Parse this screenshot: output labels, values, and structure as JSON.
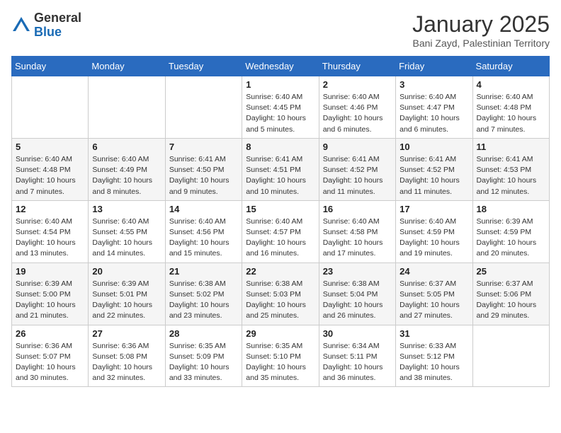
{
  "logo": {
    "general": "General",
    "blue": "Blue"
  },
  "header": {
    "month": "January 2025",
    "location": "Bani Zayd, Palestinian Territory"
  },
  "weekdays": [
    "Sunday",
    "Monday",
    "Tuesday",
    "Wednesday",
    "Thursday",
    "Friday",
    "Saturday"
  ],
  "weeks": [
    [
      {
        "day": "",
        "info": ""
      },
      {
        "day": "",
        "info": ""
      },
      {
        "day": "",
        "info": ""
      },
      {
        "day": "1",
        "info": "Sunrise: 6:40 AM\nSunset: 4:45 PM\nDaylight: 10 hours\nand 5 minutes."
      },
      {
        "day": "2",
        "info": "Sunrise: 6:40 AM\nSunset: 4:46 PM\nDaylight: 10 hours\nand 6 minutes."
      },
      {
        "day": "3",
        "info": "Sunrise: 6:40 AM\nSunset: 4:47 PM\nDaylight: 10 hours\nand 6 minutes."
      },
      {
        "day": "4",
        "info": "Sunrise: 6:40 AM\nSunset: 4:48 PM\nDaylight: 10 hours\nand 7 minutes."
      }
    ],
    [
      {
        "day": "5",
        "info": "Sunrise: 6:40 AM\nSunset: 4:48 PM\nDaylight: 10 hours\nand 7 minutes."
      },
      {
        "day": "6",
        "info": "Sunrise: 6:40 AM\nSunset: 4:49 PM\nDaylight: 10 hours\nand 8 minutes."
      },
      {
        "day": "7",
        "info": "Sunrise: 6:41 AM\nSunset: 4:50 PM\nDaylight: 10 hours\nand 9 minutes."
      },
      {
        "day": "8",
        "info": "Sunrise: 6:41 AM\nSunset: 4:51 PM\nDaylight: 10 hours\nand 10 minutes."
      },
      {
        "day": "9",
        "info": "Sunrise: 6:41 AM\nSunset: 4:52 PM\nDaylight: 10 hours\nand 11 minutes."
      },
      {
        "day": "10",
        "info": "Sunrise: 6:41 AM\nSunset: 4:52 PM\nDaylight: 10 hours\nand 11 minutes."
      },
      {
        "day": "11",
        "info": "Sunrise: 6:41 AM\nSunset: 4:53 PM\nDaylight: 10 hours\nand 12 minutes."
      }
    ],
    [
      {
        "day": "12",
        "info": "Sunrise: 6:40 AM\nSunset: 4:54 PM\nDaylight: 10 hours\nand 13 minutes."
      },
      {
        "day": "13",
        "info": "Sunrise: 6:40 AM\nSunset: 4:55 PM\nDaylight: 10 hours\nand 14 minutes."
      },
      {
        "day": "14",
        "info": "Sunrise: 6:40 AM\nSunset: 4:56 PM\nDaylight: 10 hours\nand 15 minutes."
      },
      {
        "day": "15",
        "info": "Sunrise: 6:40 AM\nSunset: 4:57 PM\nDaylight: 10 hours\nand 16 minutes."
      },
      {
        "day": "16",
        "info": "Sunrise: 6:40 AM\nSunset: 4:58 PM\nDaylight: 10 hours\nand 17 minutes."
      },
      {
        "day": "17",
        "info": "Sunrise: 6:40 AM\nSunset: 4:59 PM\nDaylight: 10 hours\nand 19 minutes."
      },
      {
        "day": "18",
        "info": "Sunrise: 6:39 AM\nSunset: 4:59 PM\nDaylight: 10 hours\nand 20 minutes."
      }
    ],
    [
      {
        "day": "19",
        "info": "Sunrise: 6:39 AM\nSunset: 5:00 PM\nDaylight: 10 hours\nand 21 minutes."
      },
      {
        "day": "20",
        "info": "Sunrise: 6:39 AM\nSunset: 5:01 PM\nDaylight: 10 hours\nand 22 minutes."
      },
      {
        "day": "21",
        "info": "Sunrise: 6:38 AM\nSunset: 5:02 PM\nDaylight: 10 hours\nand 23 minutes."
      },
      {
        "day": "22",
        "info": "Sunrise: 6:38 AM\nSunset: 5:03 PM\nDaylight: 10 hours\nand 25 minutes."
      },
      {
        "day": "23",
        "info": "Sunrise: 6:38 AM\nSunset: 5:04 PM\nDaylight: 10 hours\nand 26 minutes."
      },
      {
        "day": "24",
        "info": "Sunrise: 6:37 AM\nSunset: 5:05 PM\nDaylight: 10 hours\nand 27 minutes."
      },
      {
        "day": "25",
        "info": "Sunrise: 6:37 AM\nSunset: 5:06 PM\nDaylight: 10 hours\nand 29 minutes."
      }
    ],
    [
      {
        "day": "26",
        "info": "Sunrise: 6:36 AM\nSunset: 5:07 PM\nDaylight: 10 hours\nand 30 minutes."
      },
      {
        "day": "27",
        "info": "Sunrise: 6:36 AM\nSunset: 5:08 PM\nDaylight: 10 hours\nand 32 minutes."
      },
      {
        "day": "28",
        "info": "Sunrise: 6:35 AM\nSunset: 5:09 PM\nDaylight: 10 hours\nand 33 minutes."
      },
      {
        "day": "29",
        "info": "Sunrise: 6:35 AM\nSunset: 5:10 PM\nDaylight: 10 hours\nand 35 minutes."
      },
      {
        "day": "30",
        "info": "Sunrise: 6:34 AM\nSunset: 5:11 PM\nDaylight: 10 hours\nand 36 minutes."
      },
      {
        "day": "31",
        "info": "Sunrise: 6:33 AM\nSunset: 5:12 PM\nDaylight: 10 hours\nand 38 minutes."
      },
      {
        "day": "",
        "info": ""
      }
    ]
  ]
}
